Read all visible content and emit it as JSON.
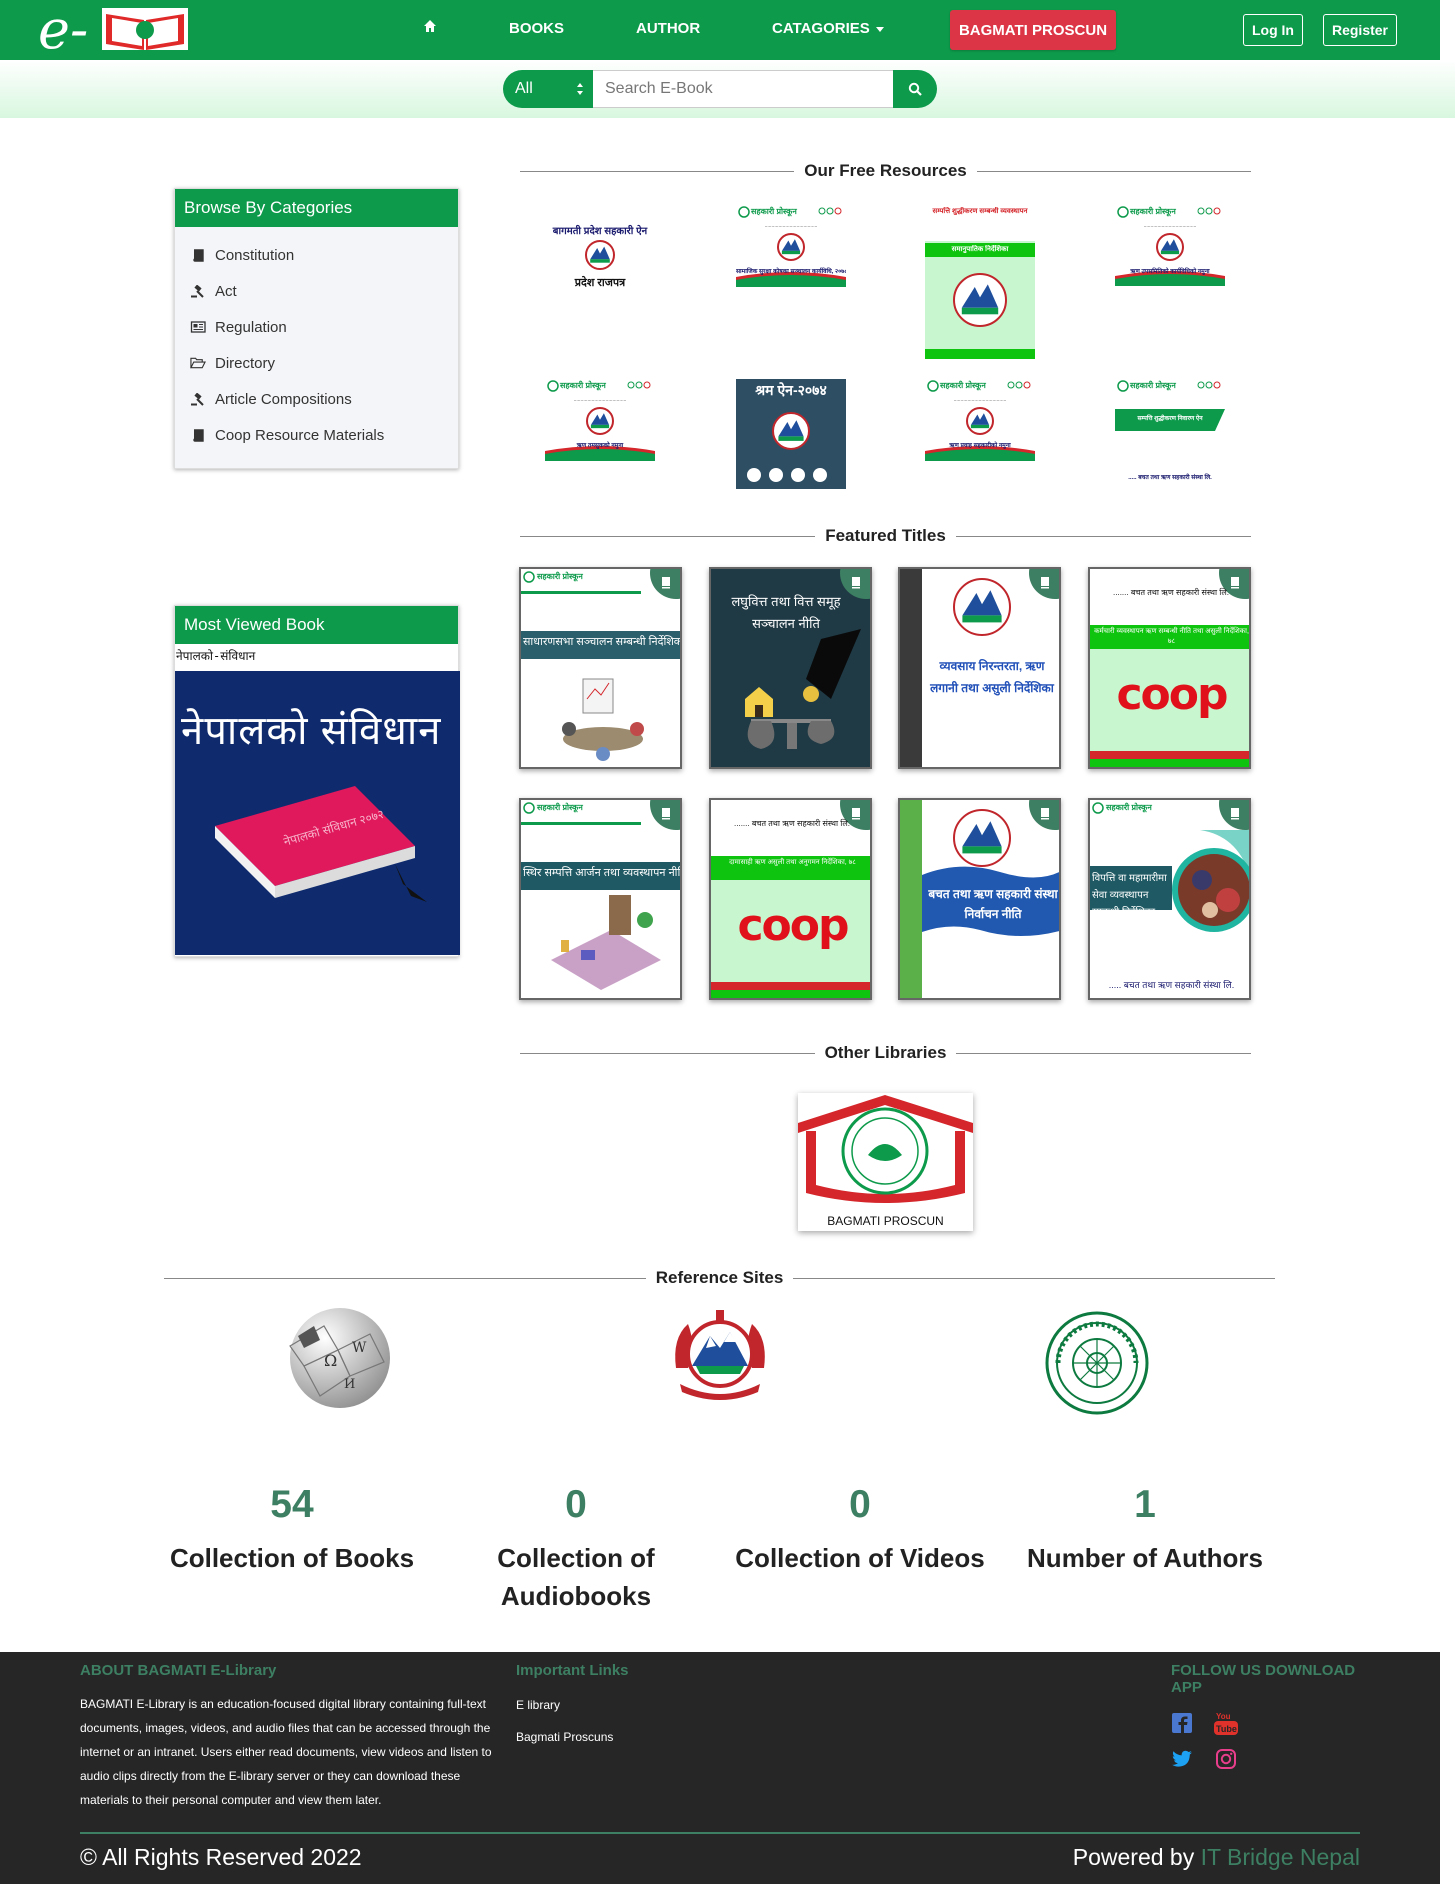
{
  "colors": {
    "brand_green": "#0d9a4b",
    "accent_green": "#3d7f62",
    "danger_red": "#dc3545",
    "footer_bg": "#262626"
  },
  "nav": {
    "logo_text": "e-",
    "home_icon": "home-icon",
    "books": "BOOKS",
    "author": "AUTHOR",
    "categories": "CATAGORIES",
    "proscun": "BAGMATI PROSCUN",
    "login": "Log In",
    "register": "Register"
  },
  "search": {
    "select_value": "All",
    "placeholder": "Search E-Book",
    "button_icon": "search-icon"
  },
  "sidebar": {
    "categories_title": "Browse By Categories",
    "categories": [
      {
        "label": "Constitution",
        "icon": "book-icon"
      },
      {
        "label": "Act",
        "icon": "gavel-icon"
      },
      {
        "label": "Regulation",
        "icon": "newspaper-icon"
      },
      {
        "label": "Directory",
        "icon": "folder-open-icon"
      },
      {
        "label": "Article Compositions",
        "icon": "gavel-icon"
      },
      {
        "label": "Coop Resource Materials",
        "icon": "book-icon"
      }
    ],
    "most_viewed_title": "Most Viewed Book",
    "most_viewed_book_title": "नेपालको-संविधान",
    "most_viewed_cover_text": "नेपालको संविधान",
    "most_viewed_book_spine": "नेपालको संविधान २०७२"
  },
  "sections": {
    "free_resources": "Our Free Resources",
    "featured": "Featured Titles",
    "other_libraries": "Other Libraries",
    "reference_sites": "Reference Sites"
  },
  "free_resources": [
    {
      "line1": "बागमती प्रदेश सहकारी ऐन",
      "line2": "प्रदेश राजपत्र"
    },
    {
      "line1": "सामाजिक सुरक्षा कोषका सञ्चालन कार्यविधि, २०७८"
    },
    {
      "line1": "सम्पत्ति शुद्धीकरण सम्बन्धी व्यवस्थापन",
      "line2": "समानुपातिक निर्देशिका"
    },
    {
      "line1": "ऋण उपसमितिको कार्यविधिको नमुना"
    },
    {
      "line1": "ऋण तमसुकको नमुना"
    },
    {
      "line1": "श्रम ऐन-२०७४"
    },
    {
      "line1": "ऋण प्रवाह सहकारीको नमुना"
    },
    {
      "line1": "सम्पत्ति शुद्धीकरण निवारण ऐन",
      "line2": "..... बचत तथा ऋण सहकारी संस्था लि."
    }
  ],
  "featured": [
    {
      "title": "साधारणसभा सञ्चालन सम्बन्धी निर्देशिका",
      "style": "band",
      "band_color": "#2a5f6b"
    },
    {
      "title": "लघुवित्त तथा वित्त समूह सञ्चालन नीति",
      "style": "dark",
      "band_color": "#1f3a45"
    },
    {
      "title": "व्यवसाय निरन्तरता, ऋण लगानी तथा असुली निर्देशिका",
      "style": "emblem",
      "band_color": "#1e5bb8"
    },
    {
      "title": "....... बचत तथा ऋण सहकारी संस्था लि.",
      "subtitle": "कर्मचारी व्यवस्थापन ऋण सम्बन्धी नीति तथा असुली निर्देशिका, ७८",
      "coop": "coop",
      "style": "coop"
    },
    {
      "title": "स्थिर सम्पत्ति आर्जन तथा व्यवस्थापन नीति",
      "style": "band",
      "band_color": "#1f5a64"
    },
    {
      "title": "....... बचत तथा ऋण सहकारी संस्था लि.",
      "subtitle": "दामासाही ऋण असुली तथा अनुगमन निर्देशिका, ७८",
      "coop": "coop",
      "style": "coop"
    },
    {
      "title": "बचत तथा ऋण सहकारी संस्था निर्वाचन नीति",
      "style": "emblem-wave",
      "band_color": "#2159b0"
    },
    {
      "title": "विपत्ति वा महामारीमा सेवा व्यवस्थापन सम्बन्धी निर्देशिका",
      "subtitle": "..... बचत तथा ऋण सहकारी संस्था लि.",
      "style": "photo",
      "band_color": "#1f5a64"
    }
  ],
  "other_libraries": [
    {
      "name": "BAGMATI PROSCUN"
    }
  ],
  "reference_sites": [
    {
      "name": "wikipedia-logo"
    },
    {
      "name": "nepal-government-emblem"
    },
    {
      "name": "cooperative-department-seal"
    }
  ],
  "stats": [
    {
      "value": "54",
      "label": "Collection of Books"
    },
    {
      "value": "0",
      "label": "Collection of Audiobooks"
    },
    {
      "value": "0",
      "label": "Collection of Videos"
    },
    {
      "value": "1",
      "label": "Number of Authors"
    }
  ],
  "footer": {
    "about_title": "ABOUT BAGMATI E-Library",
    "about_text": "BAGMATI E-Library is an education-focused digital library containing full-text documents, images, videos, and audio files that can be accessed through the internet or an intranet. Users either read documents, view videos and listen to audio clips directly from the E-library server or they can download these materials to their personal computer and view them later.",
    "links_title": "Important Links",
    "links": [
      "E library",
      "Bagmati Proscuns"
    ],
    "follow_title": "FOLLOW US DOWNLOAD APP",
    "social": [
      "facebook-icon",
      "youtube-icon",
      "twitter-icon",
      "instagram-icon"
    ],
    "copyright": "© All Rights Reserved 2022",
    "powered_prefix": "Powered by",
    "powered_brand": "IT Bridge Nepal"
  }
}
